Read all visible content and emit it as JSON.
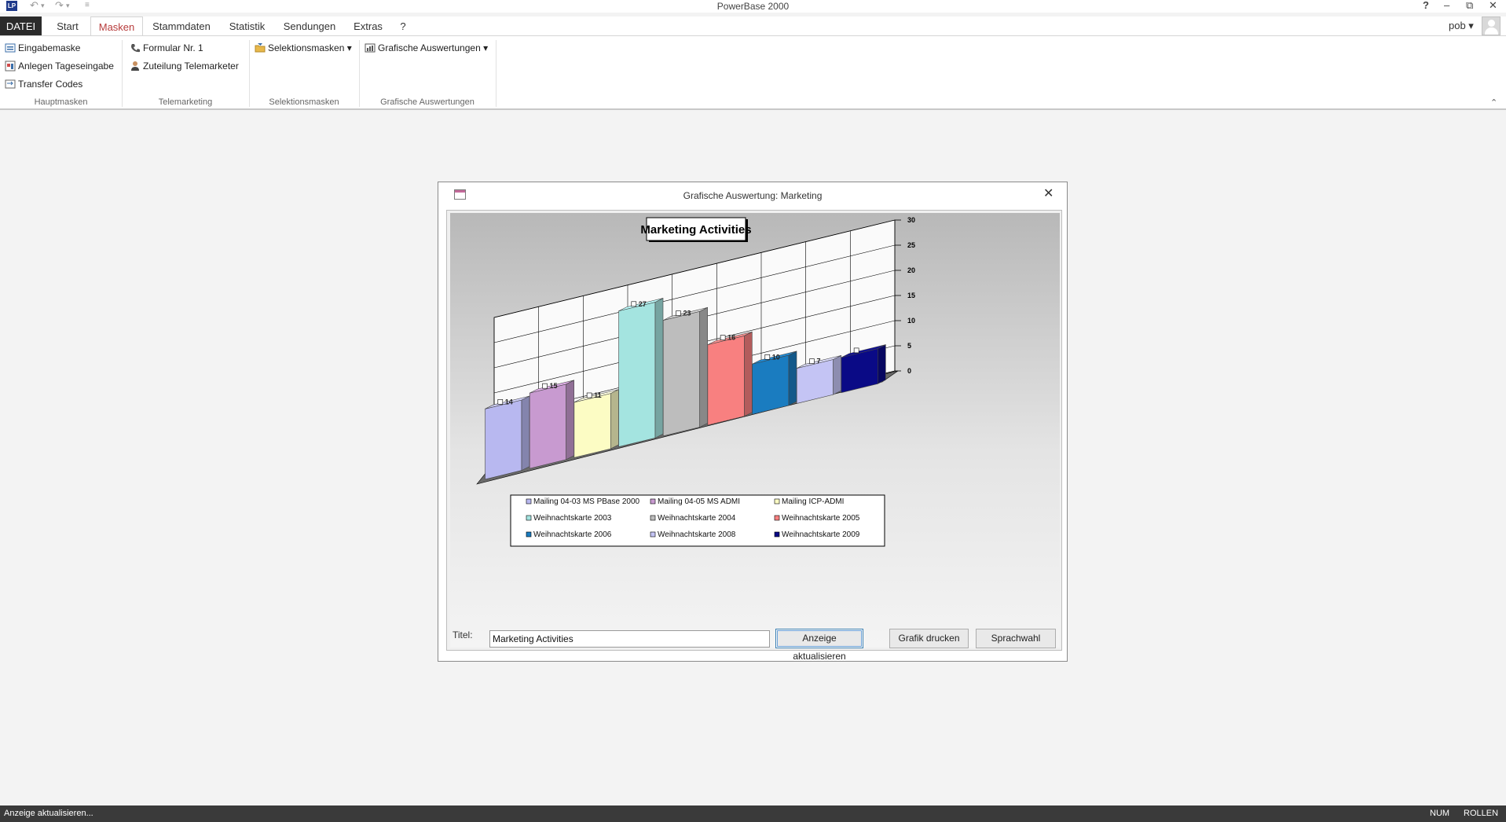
{
  "app": {
    "title": "PowerBase 2000",
    "logo": "LP"
  },
  "quick_access": {
    "undo_icon": "undo-icon",
    "redo_icon": "redo-icon",
    "customize_icon": "customize-icon"
  },
  "window_controls": {
    "help": "?",
    "minimize": "‒",
    "restore": "⧉",
    "close": "✕"
  },
  "tabs": [
    {
      "label": "DATEI"
    },
    {
      "label": "Start"
    },
    {
      "label": "Masken"
    },
    {
      "label": "Stammdaten"
    },
    {
      "label": "Statistik"
    },
    {
      "label": "Sendungen"
    },
    {
      "label": "Extras"
    },
    {
      "label": "?"
    }
  ],
  "user": {
    "name": "pob ▾"
  },
  "ribbon": {
    "hauptmasken": {
      "label": "Hauptmasken",
      "items": [
        {
          "label": "Eingabemaske"
        },
        {
          "label": "Anlegen Tageseingabe"
        },
        {
          "label": "Transfer Codes"
        }
      ]
    },
    "telemarketing": {
      "label": "Telemarketing",
      "items": [
        {
          "label": "Formular Nr. 1"
        },
        {
          "label": "Zuteilung Telemarketer"
        }
      ]
    },
    "selektionsmasken": {
      "label": "Selektionsmasken",
      "items": [
        {
          "label": "Selektionsmasken ▾"
        }
      ]
    },
    "grafische": {
      "label": "Grafische Auswertungen",
      "items": [
        {
          "label": "Grafische Auswertungen ▾"
        }
      ]
    }
  },
  "dialog": {
    "title": "Grafische Auswertung: Marketing",
    "close": "✕",
    "title_field_label": "Titel:",
    "title_field_value": "Marketing Activities",
    "buttons": {
      "refresh": "Anzeige aktualisieren",
      "print": "Grafik drucken",
      "language": "Sprachwahl"
    }
  },
  "chart_data": {
    "type": "bar",
    "title": "Marketing Activities",
    "three_d": true,
    "categories": [
      "Mailing 04-03 MS PBase 2000",
      "Mailing 04-05 MS ADMI",
      "Mailing ICP-ADMI",
      "Weihnachtskarte 2003",
      "Weihnachtskarte 2004",
      "Weihnachtskarte 2005",
      "Weihnachtskarte 2006",
      "Weihnachtskarte 2008",
      "Weihnachtskarte 2009"
    ],
    "values": [
      14,
      15,
      11,
      27,
      23,
      16,
      10,
      7,
      7
    ],
    "data_labels": [
      "14",
      "15",
      "11",
      "27",
      "23",
      "16",
      "10",
      "7",
      ""
    ],
    "colors": [
      "#b8b8f0",
      "#c89ad0",
      "#fcfcc4",
      "#a4e4e0",
      "#bdbdbd",
      "#f88080",
      "#1a7cc0",
      "#c4c4f4",
      "#0a0a86"
    ],
    "yticks": [
      0,
      5,
      10,
      15,
      20,
      25,
      30
    ],
    "ylim": [
      0,
      30
    ],
    "grid": true,
    "legend_position": "bottom"
  },
  "status": {
    "left": "Anzeige aktualisieren...",
    "num": "NUM",
    "scroll": "ROLLEN"
  }
}
